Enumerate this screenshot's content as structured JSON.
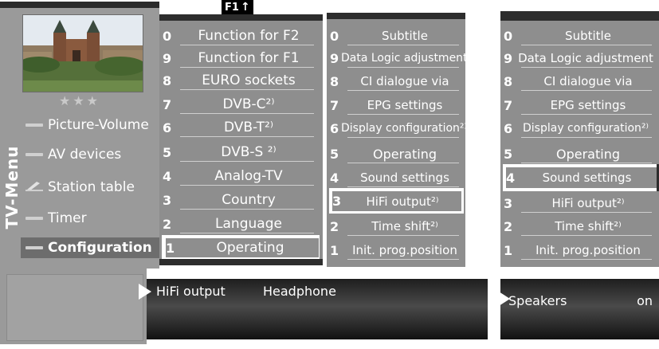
{
  "f1_label": "F1",
  "f1_arrow": "↑",
  "stars": "★★★",
  "tv_menu_title": "TV-Menu",
  "left_menu": [
    {
      "label": "Picture-Volume"
    },
    {
      "label": "AV devices"
    },
    {
      "label": "Station table"
    },
    {
      "label": "Timer"
    },
    {
      "label": "Configuration"
    }
  ],
  "config_menu": [
    {
      "num": "0",
      "label": "Function for F2"
    },
    {
      "num": "9",
      "label": "Function for F1"
    },
    {
      "num": "8",
      "label": "EURO sockets"
    },
    {
      "num": "7",
      "label": "DVB-C²⁾"
    },
    {
      "num": "6",
      "label": "DVB-T²⁾"
    },
    {
      "num": "5",
      "label": "DVB-S ²⁾"
    },
    {
      "num": "4",
      "label": "Analog-TV"
    },
    {
      "num": "3",
      "label": "Country"
    },
    {
      "num": "2",
      "label": "Language"
    },
    {
      "num": "1",
      "label": "Operating"
    }
  ],
  "operating_menu_a": [
    {
      "num": "0",
      "label": "Subtitle"
    },
    {
      "num": "9",
      "label": "Data Logic adjustment"
    },
    {
      "num": "8",
      "label": "CI dialogue via"
    },
    {
      "num": "7",
      "label": "EPG settings"
    },
    {
      "num": "6",
      "label": "Display configuration²⁾"
    },
    {
      "num": "5",
      "label": "Operating"
    },
    {
      "num": "4",
      "label": "Sound settings"
    },
    {
      "num": "3",
      "label": "HiFi output²⁾"
    },
    {
      "num": "2",
      "label": "Time shift²⁾"
    },
    {
      "num": "1",
      "label": "Init. prog.position"
    }
  ],
  "operating_menu_b": [
    {
      "num": "0",
      "label": "Subtitle"
    },
    {
      "num": "9",
      "label": "Data Logic adjustment"
    },
    {
      "num": "8",
      "label": "CI dialogue via"
    },
    {
      "num": "7",
      "label": "EPG settings"
    },
    {
      "num": "6",
      "label": "Display configuration²⁾"
    },
    {
      "num": "5",
      "label": "Operating"
    },
    {
      "num": "4",
      "label": "Sound settings"
    },
    {
      "num": "3",
      "label": "HiFi output²⁾"
    },
    {
      "num": "2",
      "label": "Time shift²⁾"
    },
    {
      "num": "1",
      "label": "Init. prog.position"
    }
  ],
  "info_bar_a": {
    "option": "HiFi output",
    "value": "Headphone"
  },
  "info_bar_b": {
    "option": "Speakers",
    "value": "on"
  }
}
